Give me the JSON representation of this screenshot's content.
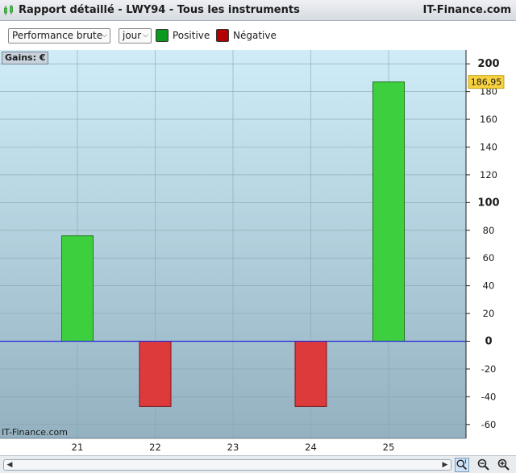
{
  "window": {
    "title": "Rapport détaillé - LWY94 - Tous les instruments",
    "brand": "IT-Finance.com"
  },
  "toolbar": {
    "metric_select": "Performance brute",
    "period_select": "jour",
    "legend": [
      {
        "label": "Positive",
        "color": "#0b9a1e"
      },
      {
        "label": "Négative",
        "color": "#b30000"
      }
    ]
  },
  "chart": {
    "axis_label": "Gains: €",
    "watermark": "IT-Finance.com",
    "highlight_value": "186,95"
  },
  "chart_data": {
    "type": "bar",
    "categories": [
      "21",
      "22",
      "23",
      "24",
      "25"
    ],
    "values": [
      76,
      -47,
      0,
      -47,
      186.95
    ],
    "ylabel": "Gains: €",
    "ylim": [
      -70,
      210
    ],
    "yticks": [
      -60,
      -40,
      -20,
      0,
      20,
      40,
      60,
      80,
      100,
      120,
      140,
      160,
      180,
      200
    ],
    "colors": {
      "positive": "#3ecf3e",
      "negative": "#dd3b3b",
      "zero_line": "#2b2bd6"
    },
    "grid": true,
    "axis_position": "right"
  }
}
